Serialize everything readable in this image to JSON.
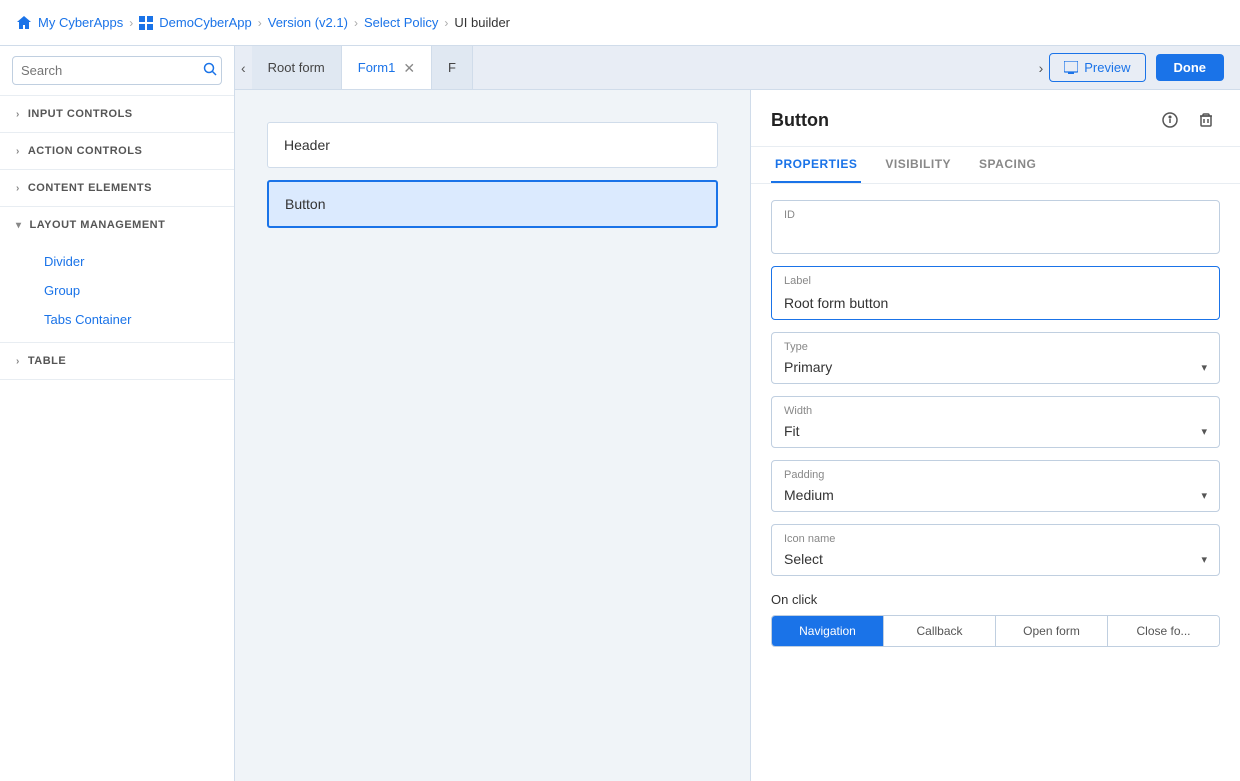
{
  "breadcrumb": {
    "items": [
      {
        "label": "My CyberApps",
        "icon": "home"
      },
      {
        "label": "DemoCyberApp",
        "icon": "grid"
      },
      {
        "label": "Version (v2.1)"
      },
      {
        "label": "Select Policy"
      },
      {
        "label": "UI builder"
      }
    ]
  },
  "sidebar": {
    "search_placeholder": "Search",
    "sections": [
      {
        "id": "input-controls",
        "label": "INPUT CONTROLS",
        "expanded": false,
        "items": []
      },
      {
        "id": "action-controls",
        "label": "ACTION CONTROLS",
        "expanded": false,
        "items": []
      },
      {
        "id": "content-elements",
        "label": "CONTENT ELEMENTS",
        "expanded": false,
        "items": []
      },
      {
        "id": "layout-management",
        "label": "LAYOUT MANAGEMENT",
        "expanded": true,
        "items": [
          "Divider",
          "Group",
          "Tabs Container"
        ]
      },
      {
        "id": "table",
        "label": "TABLE",
        "expanded": false,
        "items": []
      }
    ]
  },
  "tabs": {
    "prev_btn": "‹",
    "next_btn": "›",
    "items": [
      {
        "label": "Root form",
        "closable": false,
        "active": false
      },
      {
        "label": "Form1",
        "closable": true,
        "active": true
      },
      {
        "label": "F",
        "closable": false,
        "active": false
      }
    ]
  },
  "toolbar": {
    "preview_label": "Preview",
    "done_label": "Done"
  },
  "canvas": {
    "header_label": "Header",
    "button_label": "Button"
  },
  "right_panel": {
    "title": "Button",
    "tabs": [
      "PROPERTIES",
      "VISIBILITY",
      "SPACING"
    ],
    "active_tab": "PROPERTIES",
    "fields": {
      "id": {
        "label": "ID",
        "value": ""
      },
      "label": {
        "label": "Label",
        "value": "Root form button"
      },
      "type": {
        "label": "Type",
        "value": "Primary"
      },
      "width": {
        "label": "Width",
        "value": "Fit"
      },
      "padding": {
        "label": "Padding",
        "value": "Medium"
      },
      "icon_name": {
        "label": "Icon name",
        "value": "Select"
      }
    },
    "on_click": {
      "label": "On click",
      "tabs": [
        "Navigation",
        "Callback",
        "Open form",
        "Close fo..."
      ]
    }
  }
}
